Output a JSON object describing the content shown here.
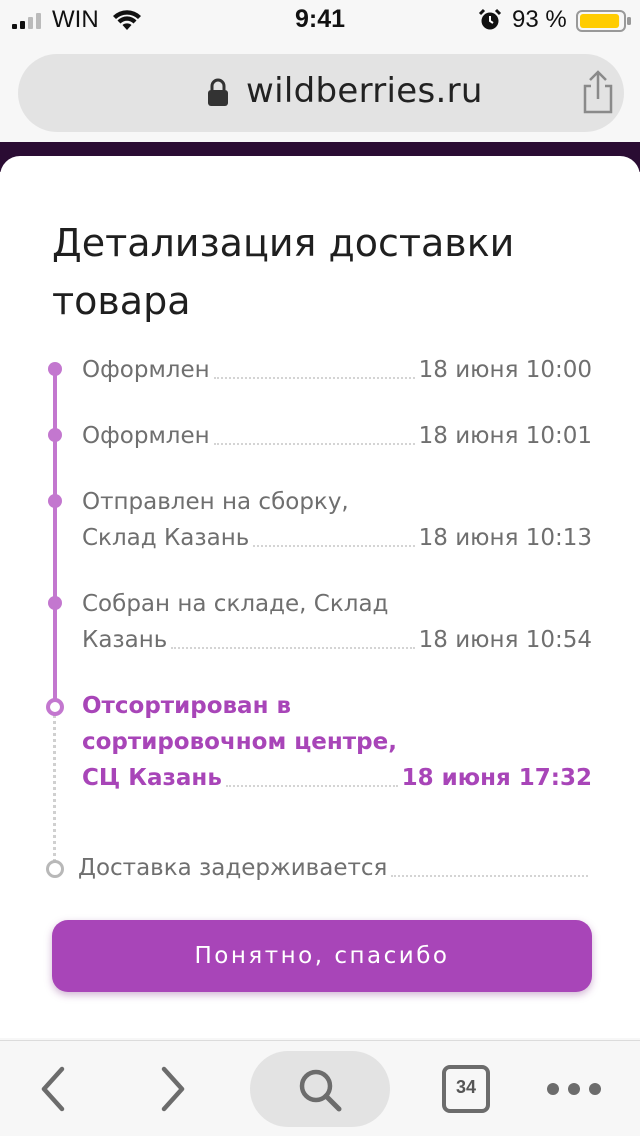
{
  "status_bar": {
    "carrier": "WIN",
    "time": "9:41",
    "battery_percent": "93 %",
    "battery_level": 0.93,
    "icons": [
      "signal-icon",
      "wifi-icon",
      "alarm-icon",
      "battery-icon"
    ]
  },
  "browser": {
    "url": "wildberries.ru",
    "tab_count": "34",
    "icons": [
      "lock-icon",
      "share-icon",
      "back-icon",
      "forward-icon",
      "search-icon",
      "tabs-icon",
      "more-icon"
    ]
  },
  "modal": {
    "title": "Детализация доставки товара",
    "events": [
      {
        "lines": [
          "Оформлен"
        ],
        "date": "18 июня 10:00",
        "state": "done"
      },
      {
        "lines": [
          "Оформлен"
        ],
        "date": "18 июня 10:01",
        "state": "done"
      },
      {
        "lines": [
          "Отправлен на сборку,",
          "Склад Казань"
        ],
        "date": "18 июня 10:13",
        "state": "done"
      },
      {
        "lines": [
          "Собран на складе, Склад",
          "Казань"
        ],
        "date": "18 июня 10:54",
        "state": "done"
      },
      {
        "lines": [
          "Отсортирован в",
          "сортировочном центре,",
          "СЦ Казань"
        ],
        "date": "18 июня 17:32",
        "state": "current"
      },
      {
        "lines": [
          "Доставка задерживается"
        ],
        "date": "",
        "state": "pending"
      }
    ],
    "button_label": "Понятно, спасибо"
  },
  "colors": {
    "accent": "#a845b8",
    "timeline": "#c377cf",
    "dark_strip": "#2a0c33",
    "battery": "#ffcc00"
  }
}
